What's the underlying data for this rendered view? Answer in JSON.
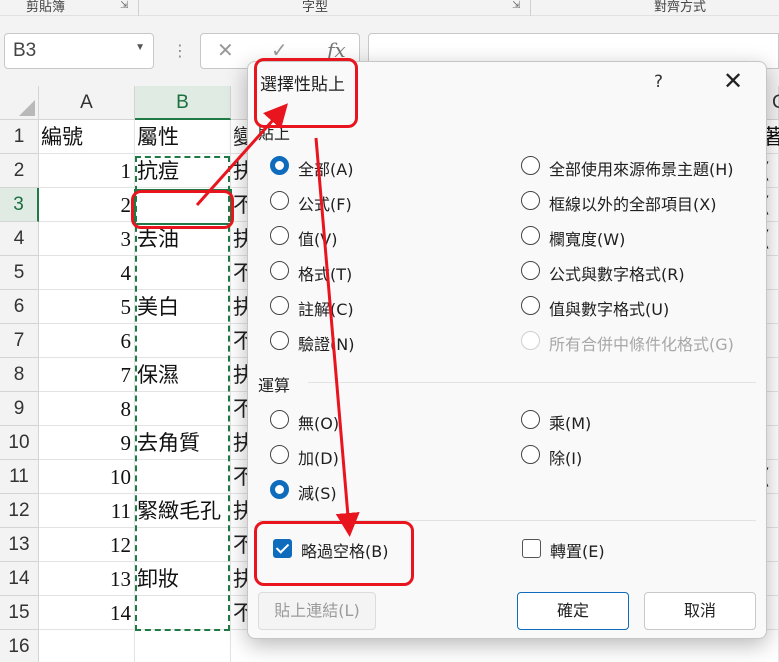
{
  "ribbon": {
    "groups": [
      "剪貼簿",
      "字型",
      "對齊方式"
    ]
  },
  "formula_bar": {
    "name_box": "B3",
    "cancel_glyph": "✕",
    "enter_glyph": "✓",
    "fx_glyph": "fx"
  },
  "sheet": {
    "columns": [
      "A",
      "B"
    ],
    "rows": [
      "1",
      "2",
      "3",
      "4",
      "5",
      "6",
      "7",
      "8",
      "9",
      "10",
      "11",
      "12",
      "13",
      "14",
      "15",
      "16"
    ],
    "col_a": [
      "編號",
      "1",
      "2",
      "3",
      "4",
      "5",
      "6",
      "7",
      "8",
      "9",
      "10",
      "11",
      "12",
      "13",
      "14",
      ""
    ],
    "col_b": [
      "屬性",
      "抗痘",
      "",
      "去油",
      "",
      "美白",
      "",
      "保濕",
      "",
      "去角質",
      "",
      "緊緻毛孔",
      "",
      "卸妝",
      "",
      ""
    ],
    "col_c_partial": [
      "變",
      "抉",
      "不",
      "抉",
      "不",
      "抉",
      "不",
      "抉",
      "不",
      "抉",
      "不",
      "抉",
      "不",
      "抉",
      "不",
      ""
    ],
    "edge_col_header": "C",
    "edge_right": [
      "著",
      "(",
      "(",
      "(",
      "",
      "",
      "",
      "",
      "",
      "",
      "(",
      "",
      "",
      "",
      "",
      ""
    ]
  },
  "dialog": {
    "title": "選擇性貼上",
    "help": "?",
    "close": "✕",
    "paste_section": "貼上",
    "paste_options_left": [
      "全部(A)",
      "公式(F)",
      "值(V)",
      "格式(T)",
      "註解(C)",
      "驗證(N)"
    ],
    "paste_options_right": [
      "全部使用來源佈景主題(H)",
      "框線以外的全部項目(X)",
      "欄寬度(W)",
      "公式與數字格式(R)",
      "值與數字格式(U)",
      "所有合併中條件化格式(G)"
    ],
    "operation_section": "運算",
    "operation_left": [
      "無(O)",
      "加(D)",
      "減(S)"
    ],
    "operation_right": [
      "乘(M)",
      "除(I)"
    ],
    "skip_blanks": "略過空格(B)",
    "transpose": "轉置(E)",
    "paste_link": "貼上連結(L)",
    "ok": "確定",
    "cancel": "取消",
    "selected_paste": "全部(A)",
    "selected_operation": "減(S)",
    "skip_blanks_checked": true,
    "transpose_checked": false
  },
  "colors": {
    "accent": "#0f6cbd",
    "excel_green": "#1f7a45",
    "annotation_red": "#e8141e"
  }
}
